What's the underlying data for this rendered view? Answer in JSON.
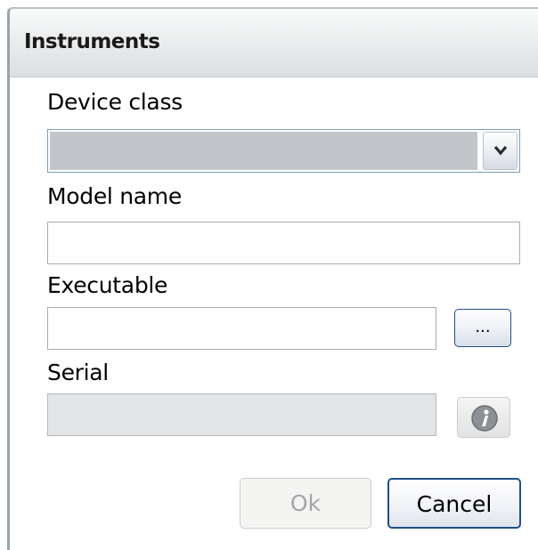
{
  "window": {
    "title": "Instruments"
  },
  "form": {
    "device_class": {
      "label": "Device class",
      "value": ""
    },
    "model_name": {
      "label": "Model name",
      "value": ""
    },
    "executable": {
      "label": "Executable",
      "value": "",
      "browse_label": "..."
    },
    "serial": {
      "label": "Serial",
      "value": "",
      "disabled": true,
      "info_icon": "info-icon"
    }
  },
  "buttons": {
    "ok_label": "Ok",
    "ok_disabled": true,
    "cancel_label": "Cancel"
  },
  "icons": {
    "dropdown": "chevron-down-icon",
    "info": "info-icon"
  },
  "colors": {
    "accent_border": "#1f4f8b",
    "combo_fill": "#c2c5c9",
    "disabled_fill": "#e3e4e6"
  }
}
